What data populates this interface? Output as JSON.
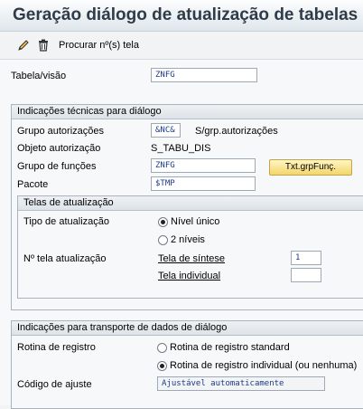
{
  "title": "Geração diálogo de atualização de tabelas",
  "toolbar": {
    "edit_icon": "pencil-icon",
    "delete_icon": "trash-icon",
    "search_label": "Procurar nº(s) tela"
  },
  "main": {
    "table_label": "Tabela/visão",
    "table_value": "ZNFG"
  },
  "tech": {
    "header": "Indicações técnicas para diálogo",
    "auth_group_label": "Grupo autorizações",
    "auth_group_value": "&NC&",
    "auth_group_desc": "S/grp.autorizações",
    "auth_object_label": "Objeto autorização",
    "auth_object_value": "S_TABU_DIS",
    "func_group_label": "Grupo de funções",
    "func_group_value": "ZNFG",
    "func_group_button": "Txt.grpFunç.",
    "package_label": "Pacote",
    "package_value": "$TMP",
    "screens": {
      "header": "Telas de atualização",
      "type_label": "Tipo de atualização",
      "type_options": [
        "Nível único",
        "2 níveis"
      ],
      "type_selected": "Nível único",
      "screen_no_label": "Nº tela atualização",
      "summary_label": "Tela de síntese",
      "summary_value": "1",
      "individual_label": "Tela individual",
      "individual_value": ""
    }
  },
  "transport": {
    "header": "Indicações para transporte de dados de diálogo",
    "routine_label": "Rotina de registro",
    "routine_options": [
      "Rotina de registro standard",
      "Rotina de registro individual (ou nenhuma)"
    ],
    "routine_selected": "Rotina de registro individual (ou nenhuma)",
    "compare_label": "Código de ajuste",
    "compare_value": "Ajustável automaticamente"
  }
}
